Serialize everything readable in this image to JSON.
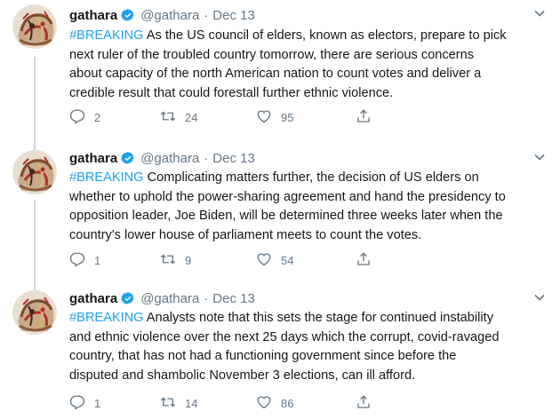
{
  "author": {
    "display_name": "gathara",
    "handle": "@gathara",
    "verified": true
  },
  "colors": {
    "hashtag": "#1da1f2",
    "verified_badge": "#1da1f2",
    "muted_text": "#657786",
    "thread_line": "#ccd6dd"
  },
  "icons": {
    "reply": "reply-icon",
    "retweet": "retweet-icon",
    "like": "like-icon",
    "share": "share-icon",
    "menu": "chevron-down-icon",
    "verified": "verified-badge-icon"
  },
  "tweets": [
    {
      "date": "Dec 13",
      "hashtag": "#BREAKING",
      "text_lines": [
        " As the US council of elders, known as electors, prepare to pick",
        "next ruler of the troubled country tomorrow, there are serious concerns",
        "about capacity of the north American nation to count votes and deliver a",
        "credible result that could forestall further ethnic violence."
      ],
      "replies": "2",
      "retweets": "24",
      "likes": "95"
    },
    {
      "date": "Dec 13",
      "hashtag": "#BREAKING",
      "text_lines": [
        " Complicating matters further, the decision of US elders on",
        "whether to uphold the power-sharing agreement and hand the presidency to",
        "opposition leader, Joe Biden, will be determined three weeks later when the",
        "country's lower house of parliament meets to count the votes."
      ],
      "replies": "1",
      "retweets": "9",
      "likes": "54"
    },
    {
      "date": "Dec 13",
      "hashtag": "#BREAKING",
      "text_lines": [
        " Analysts note that this sets the stage for continued instability",
        "and ethnic violence over the next 25 days which the corrupt, covid-ravaged",
        "country, that has not had a functioning government since before the",
        "disputed and shambolic November 3 elections, can ill afford."
      ],
      "replies": "1",
      "retweets": "14",
      "likes": "86"
    }
  ]
}
